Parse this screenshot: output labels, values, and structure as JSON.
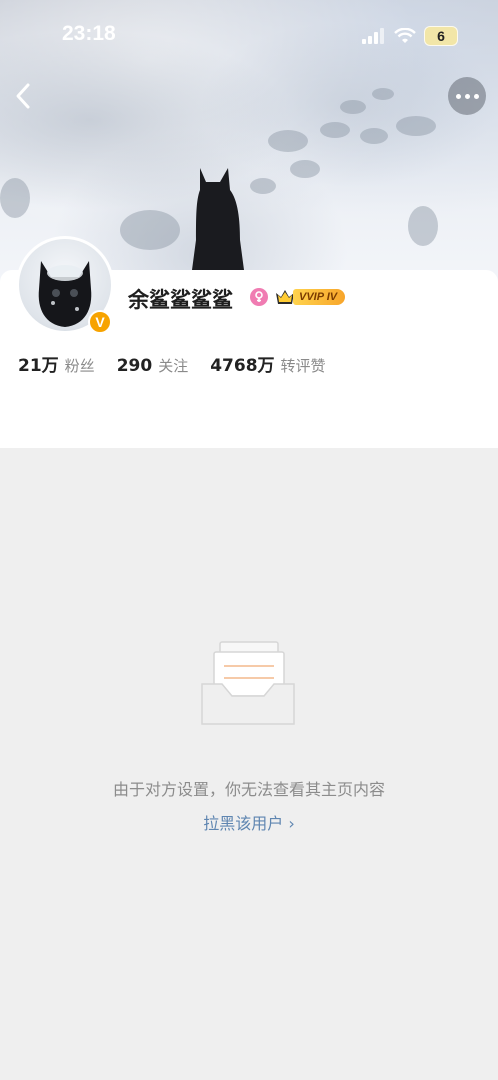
{
  "status_bar": {
    "time": "23:18",
    "battery": "6"
  },
  "profile": {
    "username": "余鲨鲨鲨鲨",
    "verified_mark": "V",
    "vip_label": "VVIP IV"
  },
  "stats": [
    {
      "value": "21万",
      "label": "粉丝"
    },
    {
      "value": "290",
      "label": "关注"
    },
    {
      "value": "4768万",
      "label": "转评赞"
    }
  ],
  "empty_state": {
    "message": "由于对方设置，你无法查看其主页内容",
    "action_label": "拉黑该用户 ›"
  },
  "colors": {
    "link": "#5f86b1",
    "verified": "#f7a300",
    "female_icon": "#f07cb2"
  },
  "icons": [
    "back-arrow-icon",
    "more-dots-icon",
    "signal-icon",
    "wifi-icon",
    "battery-icon",
    "female-icon",
    "vip-crown-icon",
    "empty-inbox-icon"
  ]
}
